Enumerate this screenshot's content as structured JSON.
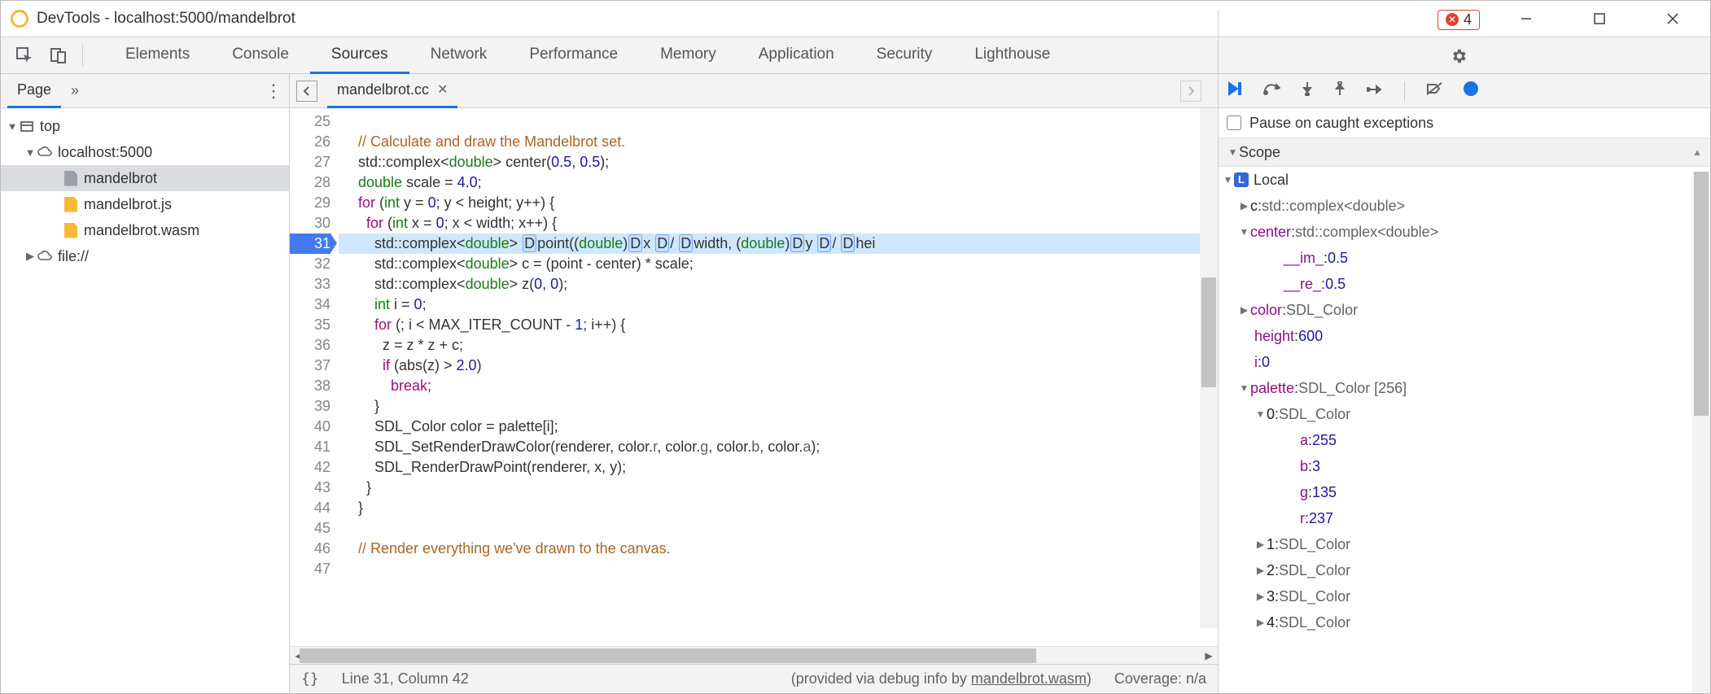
{
  "window": {
    "title": "DevTools - localhost:5000/mandelbrot"
  },
  "tabs": {
    "items": [
      "Elements",
      "Console",
      "Sources",
      "Network",
      "Performance",
      "Memory",
      "Application",
      "Security",
      "Lighthouse"
    ],
    "active": "Sources",
    "error_count": "4"
  },
  "nav": {
    "page_tab": "Page",
    "tree": {
      "top": "top",
      "host": "localhost:5000",
      "file_protocol": "file://",
      "files": [
        "mandelbrot",
        "mandelbrot.js",
        "mandelbrot.wasm"
      ],
      "selected": "mandelbrot"
    }
  },
  "editor": {
    "tab": "mandelbrot.cc",
    "first_line_no": 25,
    "breakpoint_line": 31,
    "code_html": [
      "&nbsp;",
      "  <span class='cm'>// Calculate and draw the Mandelbrot set.</span>",
      "  std::complex&lt;<span class='cty'>double</span>&gt; center(<span class='cnum'>0.5</span>, <span class='cnum'>0.5</span>);",
      "  <span class='cty'>double</span> scale = <span class='cnum'>4.0</span>;",
      "  <span class='ckw'>for</span> (<span class='cty'>int</span> y = <span class='cnum'>0</span>; y &lt; height; y++) {",
      "    <span class='ckw'>for</span> (<span class='cty'>int</span> x = <span class='cnum'>0</span>; x &lt; width; x++) {",
      "      std::complex&lt;<span class='cty'>double</span>&gt; <span class='dlit'>D</span>point((<span class='cty'>double</span>)<span class='dlit'>D</span>x <span class='dlit'>D</span>/ <span class='dlit'>D</span>width, (<span class='cty'>double</span>)<span class='dlit'>D</span>y <span class='dlit'>D</span>/ <span class='dlit'>D</span>hei",
      "      std::complex&lt;<span class='cty'>double</span>&gt; c = (point - center) * scale;",
      "      std::complex&lt;<span class='cty'>double</span>&gt; z(<span class='cnum'>0</span>, <span class='cnum'>0</span>);",
      "      <span class='cty'>int</span> i = <span class='cnum'>0</span>;",
      "      <span class='ckw'>for</span> (; i &lt; MAX_ITER_COUNT - <span class='cnum'>1</span>; i++) {",
      "        z = z * z + c;",
      "        <span class='ckw'>if</span> (abs(z) &gt; <span class='cnum'>2.0</span>)",
      "          <span class='ckw'>break</span>;",
      "      }",
      "      SDL_Color color = palette[i];",
      "      SDL_SetRenderDrawColor(renderer, color.<span class='k-type'>r</span>, color.<span class='k-type'>g</span>, color.<span class='k-type'>b</span>, color.<span class='k-type'>a</span>);",
      "      SDL_RenderDrawPoint(renderer, x, y);",
      "    }",
      "  }",
      "&nbsp;",
      "  <span class='cm'>// Render everything we've drawn to the canvas.</span>",
      "&nbsp;"
    ]
  },
  "status": {
    "braces": "{}",
    "pos": "Line 31, Column 42",
    "source_prefix": "(provided via debug info by ",
    "source_link": "mandelbrot.wasm",
    "source_suffix": ")",
    "coverage": "Coverage: n/a"
  },
  "debugger": {
    "pause_caught": "Pause on caught exceptions",
    "scope_label": "Scope",
    "local_label": "Local",
    "vars": {
      "c": {
        "name": "c",
        "type": "std::complex<double>"
      },
      "center": {
        "name": "center",
        "type": "std::complex<double>",
        "im_key": "__im_",
        "im_val": "0.5",
        "re_key": "__re_",
        "re_val": "0.5"
      },
      "color": {
        "name": "color",
        "type": "SDL_Color"
      },
      "height": {
        "name": "height",
        "val": "600"
      },
      "i": {
        "name": "i",
        "val": "0"
      },
      "palette": {
        "name": "palette",
        "type": "SDL_Color [256]",
        "item0": {
          "idx": "0",
          "type": "SDL_Color",
          "a": "255",
          "b": "3",
          "g": "135",
          "r": "237"
        },
        "item1": {
          "idx": "1",
          "type": "SDL_Color"
        },
        "item2": {
          "idx": "2",
          "type": "SDL_Color"
        },
        "item3": {
          "idx": "3",
          "type": "SDL_Color"
        },
        "item4": {
          "idx": "4",
          "type": "SDL_Color"
        }
      }
    }
  }
}
